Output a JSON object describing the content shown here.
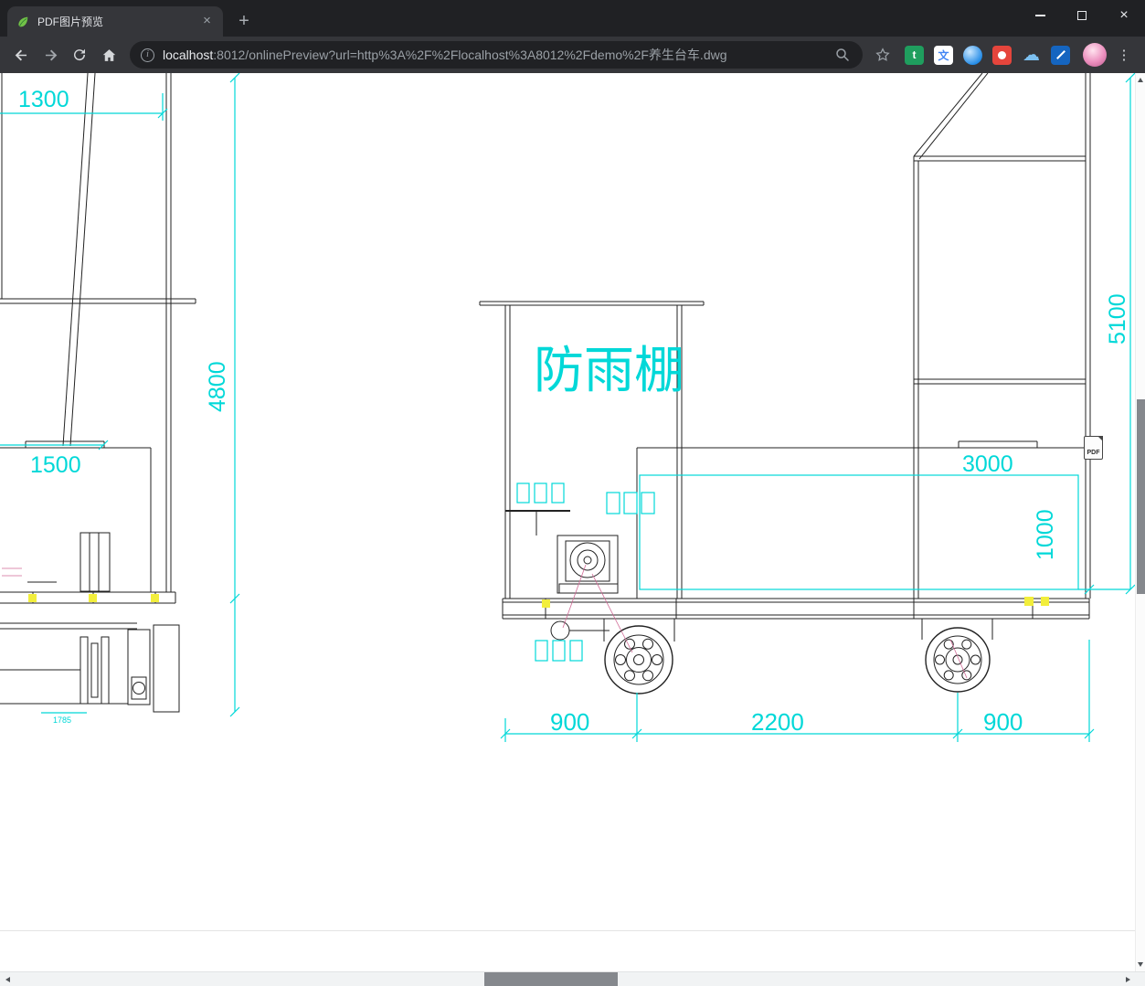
{
  "browser": {
    "tab": {
      "title": "PDF图片预览"
    },
    "tab_close": "×",
    "new_tab": "+",
    "window_controls": {
      "close": "×"
    },
    "omnibox": {
      "info": "i",
      "host": "localhost",
      "path": ":8012/onlinePreview?url=http%3A%2F%2Flocalhost%3A8012%2Fdemo%2F养生台车.dwg"
    },
    "icons": {
      "star": "☆",
      "menu": "⋮",
      "ext1": "t",
      "ext2": "文",
      "ext5": "☁"
    }
  },
  "drawing": {
    "canopy_label": "防雨棚",
    "dims": {
      "d1300": "1300",
      "d4800": "4800",
      "d1500": "1500",
      "d1785": "1785",
      "d5100": "5100",
      "d3000": "3000",
      "d1000": "1000",
      "d900l": "900",
      "d2200": "2200",
      "d900r": "900"
    },
    "pdf_badge": "PDF",
    "colors": {
      "dimension": "#00d8d8",
      "line": "#222222",
      "highlight": "#f2ee3c"
    }
  }
}
